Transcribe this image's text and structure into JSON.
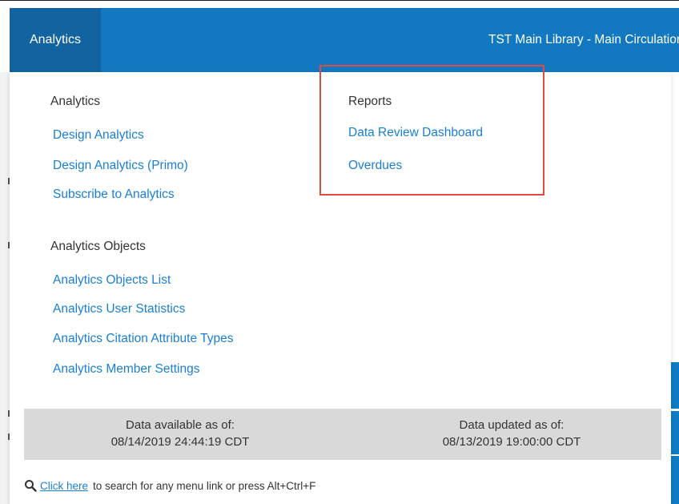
{
  "header": {
    "active_tab": "Analytics",
    "library_context": "TST Main Library - Main Circulation Desk"
  },
  "analytics_section": {
    "heading": "Analytics",
    "items": [
      {
        "label": "Design Analytics"
      },
      {
        "label": "Design Analytics (Primo)"
      },
      {
        "label": "Subscribe to Analytics"
      }
    ]
  },
  "objects_section": {
    "heading": "Analytics Objects",
    "items": [
      {
        "label": "Analytics Objects List"
      },
      {
        "label": "Analytics User Statistics"
      },
      {
        "label": "Analytics Citation Attribute Types"
      },
      {
        "label": "Analytics Member Settings"
      }
    ]
  },
  "reports_section": {
    "heading": "Reports",
    "items": [
      {
        "label": "Data Review Dashboard"
      },
      {
        "label": "Overdues"
      }
    ]
  },
  "data_info": {
    "available_label": "Data available as of:",
    "available_value": "08/14/2019 24:44:19 CDT",
    "updated_label": "Data updated as of:",
    "updated_value": "08/13/2019 19:00:00 CDT"
  },
  "footer": {
    "link_text": "Click here",
    "hint_text": "to search for any menu link or press Alt+Ctrl+F"
  },
  "colors": {
    "header_blue": "#1279c1",
    "active_tab_blue": "#1264a0",
    "link_blue": "#1a7fd1",
    "highlight_red": "#e04a43",
    "info_bar_gray": "#d9d9d9"
  },
  "icons": {
    "footer_icon": "search-icon"
  }
}
